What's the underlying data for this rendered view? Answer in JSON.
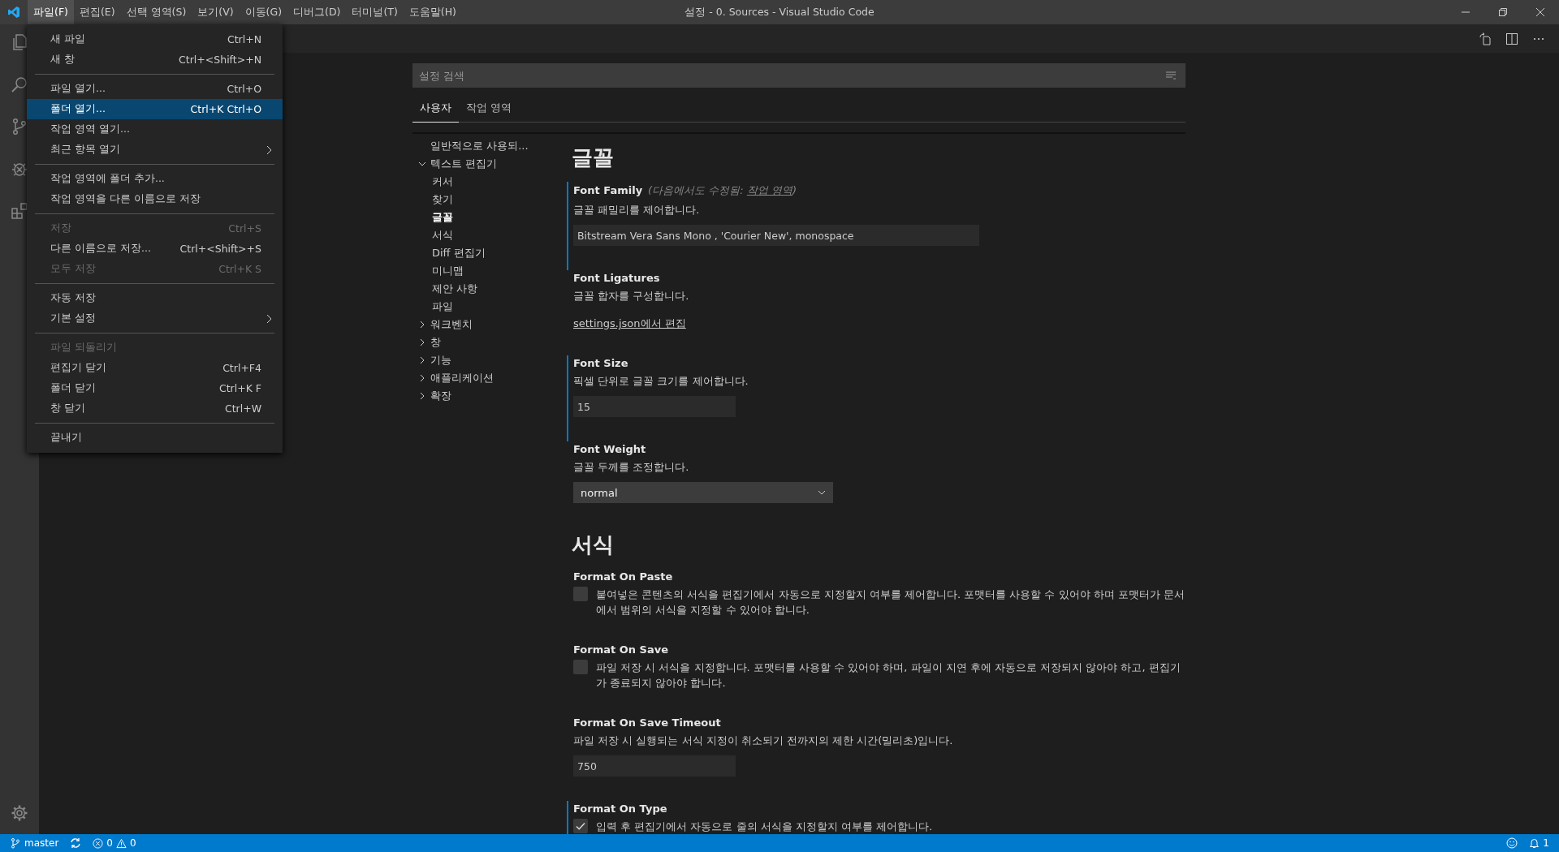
{
  "window": {
    "title": "설정 - 0. Sources - Visual Studio Code"
  },
  "menubar": [
    {
      "label": "파일(F)",
      "selected": true
    },
    {
      "label": "편집(E)",
      "selected": false
    },
    {
      "label": "선택 영역(S)",
      "selected": false
    },
    {
      "label": "보기(V)",
      "selected": false
    },
    {
      "label": "이동(G)",
      "selected": false
    },
    {
      "label": "디버그(D)",
      "selected": false
    },
    {
      "label": "터미널(T)",
      "selected": false
    },
    {
      "label": "도움말(H)",
      "selected": false
    }
  ],
  "file_menu": [
    [
      {
        "label": "새 파일",
        "shortcut": "Ctrl+N",
        "disabled": false,
        "selected": false,
        "kind": "command"
      },
      {
        "label": "새 창",
        "shortcut": "Ctrl+<Shift>+N",
        "disabled": false,
        "selected": false,
        "kind": "command"
      }
    ],
    [
      {
        "label": "파일 열기...",
        "shortcut": "Ctrl+O",
        "disabled": false,
        "selected": false,
        "kind": "command"
      },
      {
        "label": "폴더 열기...",
        "shortcut": "Ctrl+K Ctrl+O",
        "disabled": false,
        "selected": true,
        "kind": "command"
      },
      {
        "label": "작업 영역 열기...",
        "disabled": false,
        "selected": false,
        "kind": "command"
      },
      {
        "label": "최근 항목 열기",
        "disabled": false,
        "selected": false,
        "kind": "submenu"
      }
    ],
    [
      {
        "label": "작업 영역에 폴더 추가...",
        "disabled": false,
        "selected": false,
        "kind": "command"
      },
      {
        "label": "작업 영역을 다른 이름으로 저장",
        "disabled": false,
        "selected": false,
        "kind": "command"
      }
    ],
    [
      {
        "label": "저장",
        "shortcut": "Ctrl+S",
        "disabled": true,
        "selected": false,
        "kind": "command"
      },
      {
        "label": "다른 이름으로 저장...",
        "shortcut": "Ctrl+<Shift>+S",
        "disabled": false,
        "selected": false,
        "kind": "command"
      },
      {
        "label": "모두 저장",
        "shortcut": "Ctrl+K S",
        "disabled": true,
        "selected": false,
        "kind": "command"
      }
    ],
    [
      {
        "label": "자동 저장",
        "disabled": false,
        "selected": false,
        "kind": "command"
      },
      {
        "label": "기본 설정",
        "disabled": false,
        "selected": false,
        "kind": "submenu"
      }
    ],
    [
      {
        "label": "파일 되돌리기",
        "disabled": true,
        "selected": false,
        "kind": "command"
      },
      {
        "label": "편집기 닫기",
        "shortcut": "Ctrl+F4",
        "disabled": false,
        "selected": false,
        "kind": "command"
      },
      {
        "label": "폴더 닫기",
        "shortcut": "Ctrl+K F",
        "disabled": false,
        "selected": false,
        "kind": "command"
      },
      {
        "label": "창 닫기",
        "shortcut": "Ctrl+W",
        "disabled": false,
        "selected": false,
        "kind": "command"
      }
    ],
    [
      {
        "label": "끝내기",
        "disabled": false,
        "selected": false,
        "kind": "command"
      }
    ]
  ],
  "settings": {
    "search": {
      "placeholder": "설정 검색"
    },
    "tabs": [
      {
        "label": "사용자",
        "selected": true
      },
      {
        "label": "작업 영역",
        "selected": false
      }
    ],
    "tree": [
      {
        "label": "일반적으로 사용되...",
        "selected": false
      },
      {
        "label": "텍스트 편집기",
        "expanded": true,
        "selected": false,
        "children": [
          {
            "label": "커서",
            "selected": false
          },
          {
            "label": "찾기",
            "selected": false
          },
          {
            "label": "글꼴",
            "selected": true
          },
          {
            "label": "서식",
            "selected": false
          },
          {
            "label": "Diff 편집기",
            "selected": false
          },
          {
            "label": "미니맵",
            "selected": false
          },
          {
            "label": "제안 사항",
            "selected": false
          },
          {
            "label": "파일",
            "selected": false
          }
        ]
      },
      {
        "label": "워크벤치",
        "expanded": false,
        "selected": false
      },
      {
        "label": "창",
        "expanded": false,
        "selected": false
      },
      {
        "label": "기능",
        "expanded": false,
        "selected": false
      },
      {
        "label": "애플리케이션",
        "expanded": false,
        "selected": false
      },
      {
        "label": "확장",
        "expanded": false,
        "selected": false
      }
    ],
    "sections": [
      {
        "heading": "글꼴",
        "items": [
          {
            "kind": "text",
            "title": "Font Family",
            "modified": true,
            "note": "(다음에서도 수정됨: ",
            "note_link": "작업 영역",
            "note_end": ")",
            "description": "글꼴 패밀리를 제어합니다.",
            "value": "Bitstream Vera Sans Mono , 'Courier New', monospace"
          },
          {
            "kind": "link",
            "title": "Font Ligatures",
            "modified": false,
            "description": "글꼴 합자를 구성합니다.",
            "link": "settings.json에서 편집"
          },
          {
            "kind": "number",
            "title": "Font Size",
            "modified": true,
            "description": "픽셀 단위로 글꼴 크기를 제어합니다.",
            "value": "15"
          },
          {
            "kind": "select",
            "title": "Font Weight",
            "modified": false,
            "description": "글꼴 두께를 조정합니다.",
            "value": "normal"
          }
        ]
      },
      {
        "heading": "서식",
        "items": [
          {
            "kind": "checkbox",
            "title": "Format On Paste",
            "modified": false,
            "checked": false,
            "description": "붙여넣은 콘텐츠의 서식을 편집기에서 자동으로 지정할지 여부를 제어합니다. 포맷터를 사용할 수 있어야 하며 포맷터가 문서에서 범위의 서식을 지정할 수 있어야 합니다."
          },
          {
            "kind": "checkbox",
            "title": "Format On Save",
            "modified": false,
            "checked": false,
            "description": "파일 저장 시 서식을 지정합니다. 포맷터를 사용할 수 있어야 하며, 파일이 지연 후에 자동으로 저장되지 않아야 하고, 편집기가 종료되지 않아야 합니다."
          },
          {
            "kind": "number",
            "title": "Format On Save Timeout",
            "modified": false,
            "description": "파일 저장 시 실행되는 서식 지정이 취소되기 전까지의 제한 시간(밀리초)입니다.",
            "value": "750"
          },
          {
            "kind": "checkbox",
            "title": "Format On Type",
            "modified": true,
            "checked": true,
            "description": "입력 후 편집기에서 자동으로 줄의 서식을 지정할지 여부를 제어합니다."
          }
        ]
      }
    ]
  },
  "status_bar": {
    "branch": "master",
    "errors": "0",
    "warnings": "0",
    "notifications": "1"
  }
}
